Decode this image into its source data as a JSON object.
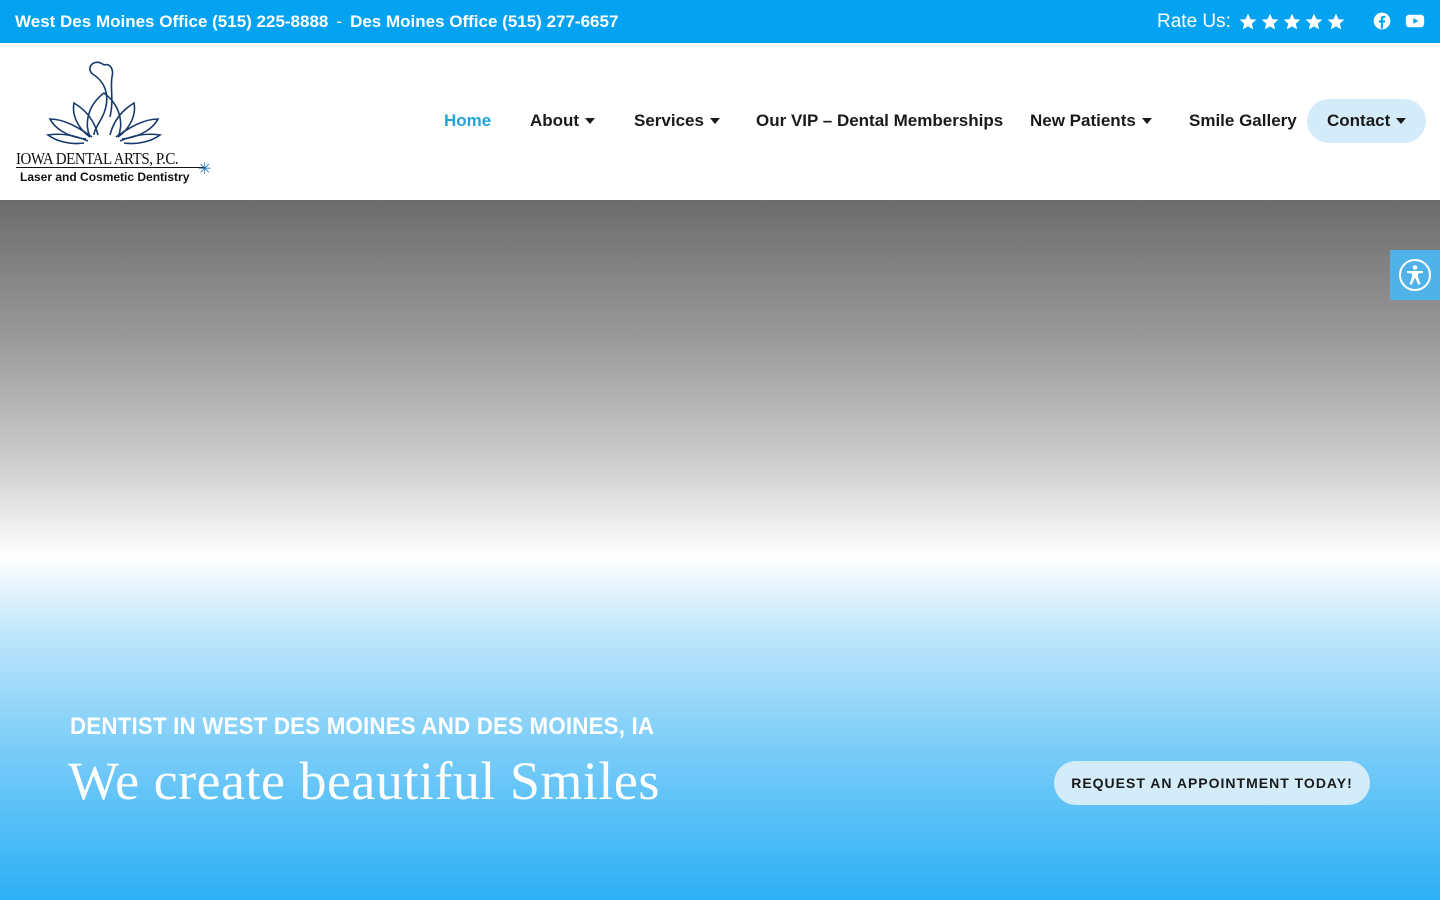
{
  "topbar": {
    "west_office": "West Des Moines Office (515) 225-8888",
    "separator": "-",
    "dm_office": "Des Moines Office (515) 277-6657",
    "rate_label": "Rate Us:",
    "star_count": 5,
    "social": [
      "facebook-icon",
      "youtube-icon"
    ],
    "background": "#03a3f1"
  },
  "logo": {
    "name": "IOWA DENTAL ARTS, P.C.",
    "tagline": "Laser and Cosmetic Dentistry"
  },
  "nav": {
    "items": [
      {
        "label": "Home",
        "active": true
      },
      {
        "label": "About",
        "dropdown": true
      },
      {
        "label": "Services",
        "dropdown": true
      },
      {
        "label": "Our VIP – Dental Memberships"
      },
      {
        "label": "New Patients",
        "dropdown": true
      },
      {
        "label": "Smile Gallery"
      },
      {
        "label": "Contact",
        "dropdown": true
      }
    ],
    "active_color": "#22a3dc",
    "pill_color": "#d4ebfa"
  },
  "hero": {
    "eyebrow": "DENTIST IN WEST DES MOINES AND DES MOINES, IA",
    "title": "We create beautiful Smiles",
    "cta": "REQUEST AN APPOINTMENT TODAY!"
  },
  "accessibility": {
    "icon": "accessibility-icon"
  }
}
